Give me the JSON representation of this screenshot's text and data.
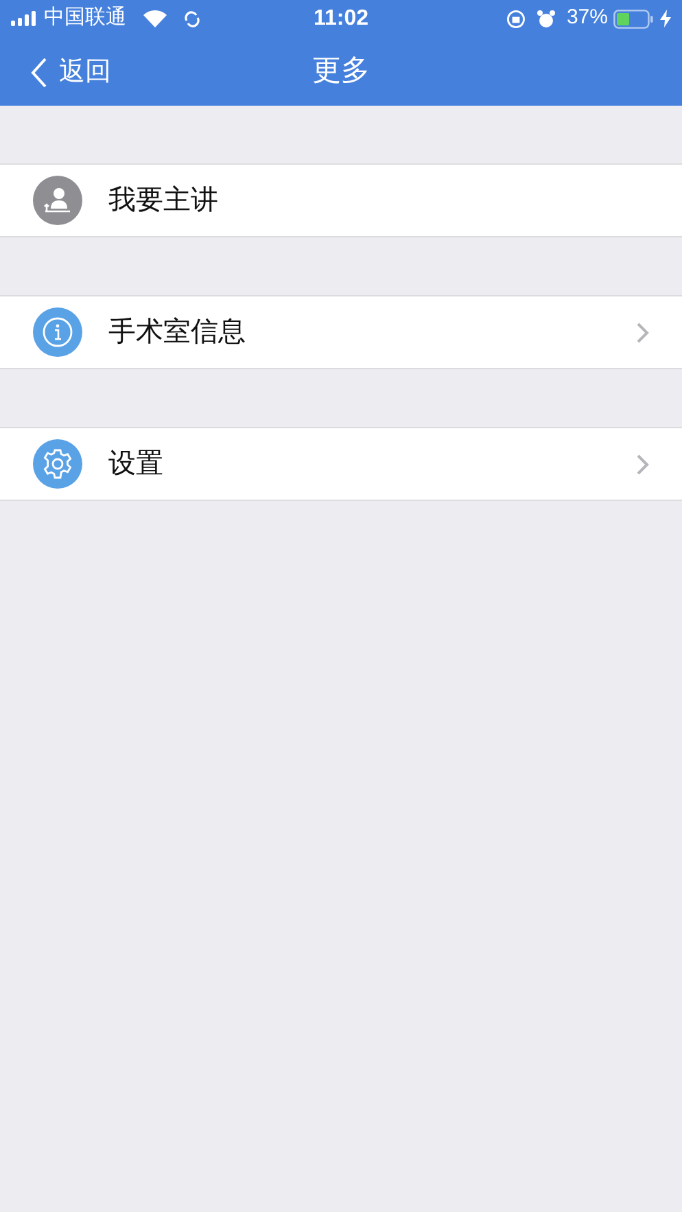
{
  "status_bar": {
    "carrier": "中国联通",
    "time": "11:02",
    "battery": "37%"
  },
  "nav_bar": {
    "back": "返回",
    "title": "更多"
  },
  "items": [
    {
      "kind": "presenter",
      "label": "我要主讲",
      "color": "#8e8e93",
      "chevron": false
    },
    {
      "kind": "info",
      "label": "手术室信息",
      "color": "#5aa2e6",
      "chevron": true
    },
    {
      "kind": "settings",
      "label": "设置",
      "color": "#5aa2e6",
      "chevron": true
    }
  ]
}
